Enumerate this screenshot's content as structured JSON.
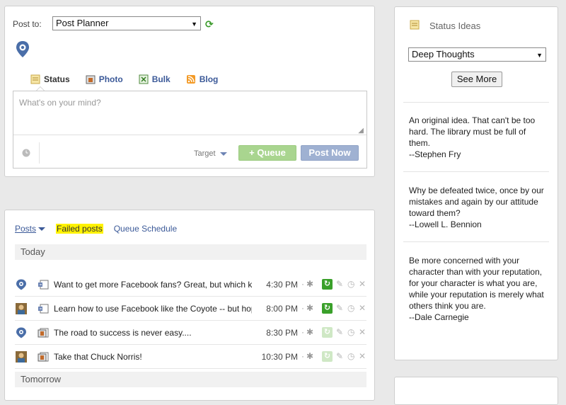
{
  "compose": {
    "post_to_label": "Post to:",
    "post_to_value": "Post Planner",
    "tabs": [
      {
        "label": "Status",
        "icon": "status-icon"
      },
      {
        "label": "Photo",
        "icon": "photo-icon"
      },
      {
        "label": "Bulk",
        "icon": "bulk-icon"
      },
      {
        "label": "Blog",
        "icon": "rss-icon"
      }
    ],
    "placeholder": "What's on your mind?",
    "target_label": "Target",
    "queue_label": "+ Queue",
    "post_now_label": "Post Now"
  },
  "posts": {
    "nav": {
      "posts": "Posts",
      "failed": "Failed posts",
      "schedule": "Queue Schedule"
    },
    "today_label": "Today",
    "tomorrow_label": "Tomorrow",
    "rows": [
      {
        "text": "Want to get more Facebook fans? Great, but which ki...",
        "time": "4:30 PM",
        "avatar": "post-planner-logo",
        "type": "link-post"
      },
      {
        "text": "Learn how to use Facebook like the Coyote -- but hop...",
        "time": "8:00 PM",
        "avatar": "user-photo",
        "type": "link-post"
      },
      {
        "text": "The road to success is never easy....",
        "time": "8:30 PM",
        "avatar": "post-planner-logo",
        "type": "photo-post"
      },
      {
        "text": "Take that Chuck Norris!",
        "time": "10:30 PM",
        "avatar": "user-photo",
        "type": "photo-post"
      }
    ]
  },
  "ideas": {
    "title": "Status Ideas",
    "category": "Deep Thoughts",
    "see_more": "See More",
    "quotes": [
      {
        "text": "An original idea. That can't be too hard. The library must be full of them.",
        "author": "--Stephen Fry"
      },
      {
        "text": "Why be defeated twice, once by our mistakes and again by our attitude toward them?",
        "author": "--Lowell L. Bennion"
      },
      {
        "text": "Be more concerned with your character than with your reputation, for your character is what you are, while your reputation is merely what others think you are.",
        "author": "--Dale Carnegie"
      }
    ]
  },
  "colors": {
    "link": "#3b5998",
    "queue": "#a9d58f",
    "post_now": "#9fb1d2",
    "highlight": "#fff200",
    "recycle": "#3aa02a"
  }
}
